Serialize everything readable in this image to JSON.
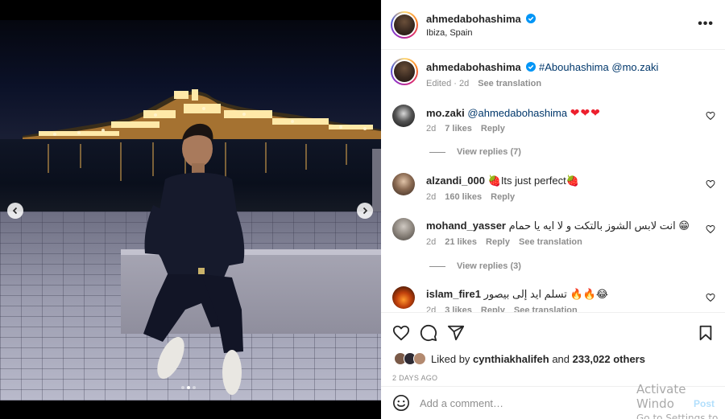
{
  "post": {
    "username": "ahmedabohashima",
    "location": "Ibiza, Spain",
    "more_label": "•••",
    "carousel": {
      "total": 3,
      "current": 2
    }
  },
  "caption": {
    "username": "ahmedabohashima",
    "hashtag": "#Abouhashima",
    "mention": "@mo.zaki",
    "edited": "Edited · 2d",
    "see_translation": "See translation"
  },
  "comments": [
    {
      "username": "mo.zaki",
      "mention": "@ahmedabohashima",
      "text": "",
      "emoji": "❤❤❤",
      "time": "2d",
      "likes": "7 likes",
      "reply": "Reply",
      "translation": "",
      "view_replies": "View replies (7)"
    },
    {
      "username": "alzandi_000",
      "mention": "",
      "text": "Its just perfect",
      "emoji": "🍓",
      "time": "2d",
      "likes": "160 likes",
      "reply": "Reply",
      "translation": "",
      "view_replies": ""
    },
    {
      "username": "mohand_yasser",
      "mention": "",
      "text": "انت لابس الشوز بالتكت و لا ايه يا حمام",
      "emoji": "😁",
      "time": "2d",
      "likes": "21 likes",
      "reply": "Reply",
      "translation": "See translation",
      "view_replies": "View replies (3)"
    },
    {
      "username": "islam_fire1",
      "mention": "",
      "text": "تسلم ايد إلى بيصور",
      "emoji": "🔥🔥😂",
      "time": "2d",
      "likes": "3 likes",
      "reply": "Reply",
      "translation": "See translation",
      "view_replies": ""
    }
  ],
  "likes": {
    "prefix": "Liked by",
    "user": "cynthiakhalifeh",
    "and": "and",
    "others": "233,022 others"
  },
  "timestamp": "2 DAYS AGO",
  "add_comment": {
    "placeholder": "Add a comment…",
    "post_label": "Post"
  },
  "watermark": {
    "line1": "Activate Windo",
    "line2": "Go to Settings to a"
  },
  "colors": {
    "verified": "#0095f6",
    "link": "#00376b",
    "secondary_text": "#8e8e8e",
    "post_disabled": "#b2dffc"
  }
}
